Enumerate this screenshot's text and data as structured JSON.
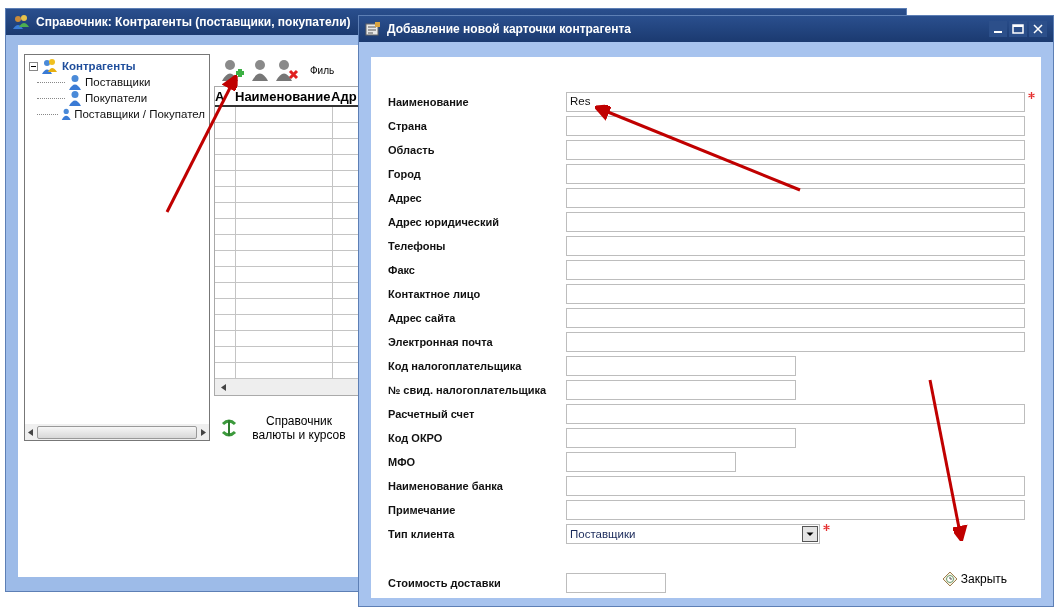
{
  "main_window": {
    "title": "Справочник: Контрагенты (поставщики, покупатели)",
    "tree": [
      {
        "label": "Контрагенты",
        "selected": true,
        "expanded": true,
        "children": [
          {
            "label": "Поставщики",
            "selected": false
          },
          {
            "label": "Покупатели",
            "selected": false
          },
          {
            "label": "Поставщики / Покупател",
            "selected": false
          }
        ]
      }
    ],
    "toolbar": {
      "filter_label": "Филь"
    },
    "table": {
      "columns": [
        "А",
        "Наименование",
        "Адр"
      ]
    },
    "currency_link": "Справочник валюты и курсов"
  },
  "dialog": {
    "title": "Добавление новой карточки контрагента",
    "fields": [
      {
        "label": "Наименование",
        "kind": "wide",
        "value": "Res",
        "required": true
      },
      {
        "label": "Страна",
        "kind": "wide",
        "required": false
      },
      {
        "label": "Область",
        "kind": "wide",
        "required": false
      },
      {
        "label": "Город",
        "kind": "wide",
        "required": false
      },
      {
        "label": "Адрес",
        "kind": "wide",
        "required": false
      },
      {
        "label": "Адрес юридический",
        "kind": "wide",
        "required": false
      },
      {
        "label": "Телефоны",
        "kind": "wide",
        "required": false
      },
      {
        "label": "Факс",
        "kind": "wide",
        "required": false
      },
      {
        "label": "Контактное лицо",
        "kind": "wide",
        "required": false
      },
      {
        "label": "Адрес сайта",
        "kind": "wide",
        "required": false
      },
      {
        "label": "Электронная почта",
        "kind": "wide",
        "required": false
      },
      {
        "label": "Код налогоплательщика",
        "kind": "medium",
        "required": false
      },
      {
        "label": "№ свид. налогоплательщика",
        "kind": "medium",
        "required": false
      },
      {
        "label": "Расчетный счет",
        "kind": "wide",
        "required": false
      },
      {
        "label": "Код ОКРО",
        "kind": "medium",
        "required": false
      },
      {
        "label": "МФО",
        "kind": "short",
        "required": false
      },
      {
        "label": "Наименование банка",
        "kind": "wide",
        "required": false
      },
      {
        "label": "Примечание",
        "kind": "wide",
        "required": false
      },
      {
        "label": "Тип клиента",
        "kind": "dropdown",
        "value": "Поставщики",
        "required": true
      }
    ],
    "delivery": {
      "label": "Стоимость доставки",
      "kind": "small"
    },
    "close_button": "Закрыть"
  }
}
